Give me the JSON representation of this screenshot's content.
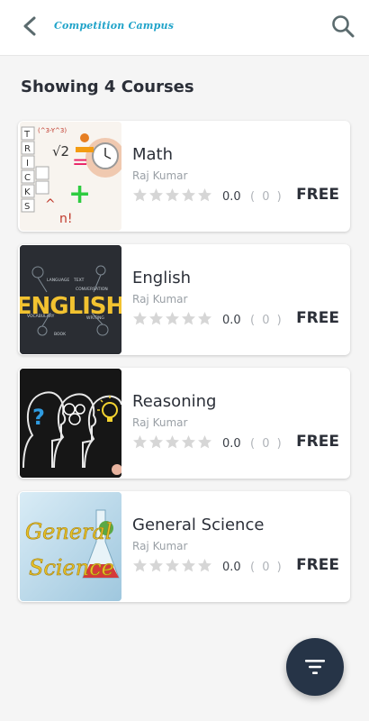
{
  "header": {
    "title": "Competition Campus",
    "back_icon": "back-arrow-icon",
    "search_icon": "search-icon"
  },
  "heading": "Showing 4 Courses",
  "courses": [
    {
      "title": "Math",
      "author": "Raj  Kumar",
      "rating": "0.0",
      "reviews": "( 0 )",
      "price": "FREE",
      "stars": 0,
      "thumb": {
        "texts": [
          "TRICKS",
          "(^3-Y^3)",
          "√2",
          "=",
          "+",
          "n!",
          "^"
        ]
      }
    },
    {
      "title": "English",
      "author": "Raj  Kumar",
      "rating": "0.0",
      "reviews": "( 0 )",
      "price": "FREE",
      "stars": 0,
      "thumb": {
        "word": "ENGLISH",
        "texts": [
          "LANGUAGE",
          "TEXT",
          "CONVERSATION",
          "VOCABULARY",
          "WRITING",
          "BOOK"
        ]
      }
    },
    {
      "title": "Reasoning",
      "author": "Raj  Kumar",
      "rating": "0.0",
      "reviews": "( 0 )",
      "price": "FREE",
      "stars": 0,
      "thumb": {
        "symbol": "?"
      }
    },
    {
      "title": "General Science",
      "author": "Raj  Kumar",
      "rating": "0.0",
      "reviews": "( 0 )",
      "price": "FREE",
      "stars": 0,
      "thumb": {
        "line1": "General",
        "line2": "Science"
      }
    }
  ],
  "fab": {
    "icon": "filter-icon"
  },
  "colors": {
    "accent": "#1fa3c9",
    "fab": "#263447",
    "text": "#2b2f38",
    "star_empty": "#d6d6d6"
  }
}
